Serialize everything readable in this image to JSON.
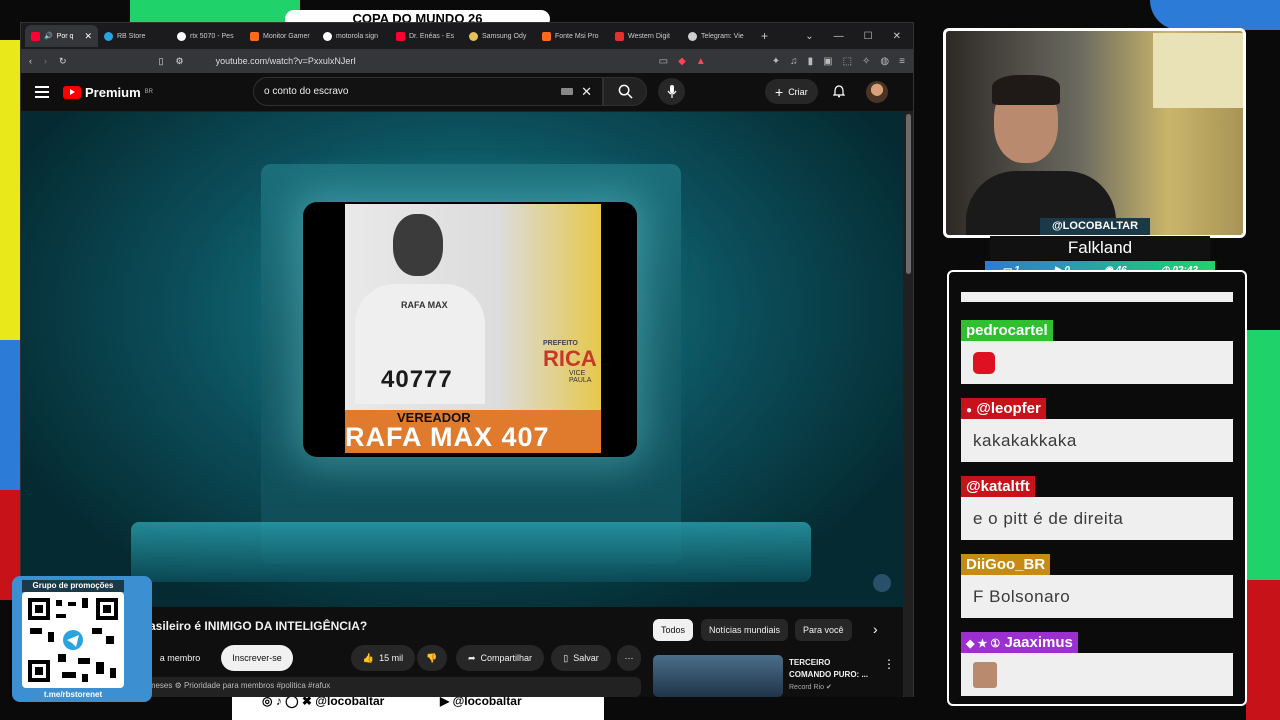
{
  "overlay": {
    "top_banner": "COPA DO MUNDO 26",
    "qr_title": "Grupo de promoções",
    "qr_link": "t.me/rbstorenet",
    "social_handle_1": "@locobaltar",
    "social_handle_2": "@locobaltar",
    "streamer_handle": "@LOCOBALTAR",
    "game": "Falkland",
    "stats": {
      "s1": "1",
      "s2": "0",
      "s3": "46",
      "time": "02:43"
    }
  },
  "tabs": [
    {
      "label": "Por q",
      "color": "#ff0033"
    },
    {
      "label": "RB Store",
      "color": "#2aa3e0"
    },
    {
      "label": "rtx 5070 - Pes",
      "color": "#ffffff"
    },
    {
      "label": "Monitor Gamer",
      "color": "#ff6a1a"
    },
    {
      "label": "motorola sign",
      "color": "#ffffff"
    },
    {
      "label": "Dr. Enéas - Es",
      "color": "#ff0033"
    },
    {
      "label": "Samsung Ody",
      "color": "#e5c15a"
    },
    {
      "label": "Fonte Msi Pro",
      "color": "#ff6a1a"
    },
    {
      "label": "Western Digit",
      "color": "#e3312b"
    },
    {
      "label": "Telegram: Vie",
      "color": "#cccccc"
    }
  ],
  "address": {
    "url": "youtube.com/watch?v=PxxulxNJerI"
  },
  "youtube": {
    "brand": "Premium",
    "region": "BR",
    "search_value": "o conto do escravo",
    "create_label": "Criar"
  },
  "poster": {
    "shirt_text": "RAFA MAX",
    "number": "40777",
    "prefeito": "PREFEITO",
    "rica": "RICA",
    "paula": "VICE PAULA",
    "vereador": "VEREADOR",
    "name_line": "RAFA MAX 407"
  },
  "video": {
    "title": "asileiro é INIMIGO DA INTELIGÊNCIA?",
    "join_label": "a membro",
    "subscribe_label": "Inscrever-se",
    "likes": "15 mil",
    "share_label": "Compartilhar",
    "save_label": "Salvar",
    "meta": "há 3 meses  ⚙ Prioridade para membros  #politica #rafux"
  },
  "sidebar": {
    "chips": [
      "Todos",
      "Notícias mundiais",
      "Para você"
    ],
    "rec_title_1": "TERCEIRO",
    "rec_title_2": "COMANDO PURO: ...",
    "rec_channel": "Record Rio ✔"
  },
  "chat": [
    {
      "user": "pedrocartel",
      "color": "#2fbf2f",
      "text": ""
    },
    {
      "user": "@leopfer",
      "color": "#c8121a",
      "text": "kakakakkaka"
    },
    {
      "user": "@kataltft",
      "color": "#c8121a",
      "text": "e o pitt é de direita"
    },
    {
      "user": "DiiGoo_BR",
      "color": "#c78a12",
      "text": "F Bolsonaro"
    },
    {
      "user": "Jaaximus",
      "color": "#9b2fd0",
      "text": ""
    }
  ]
}
